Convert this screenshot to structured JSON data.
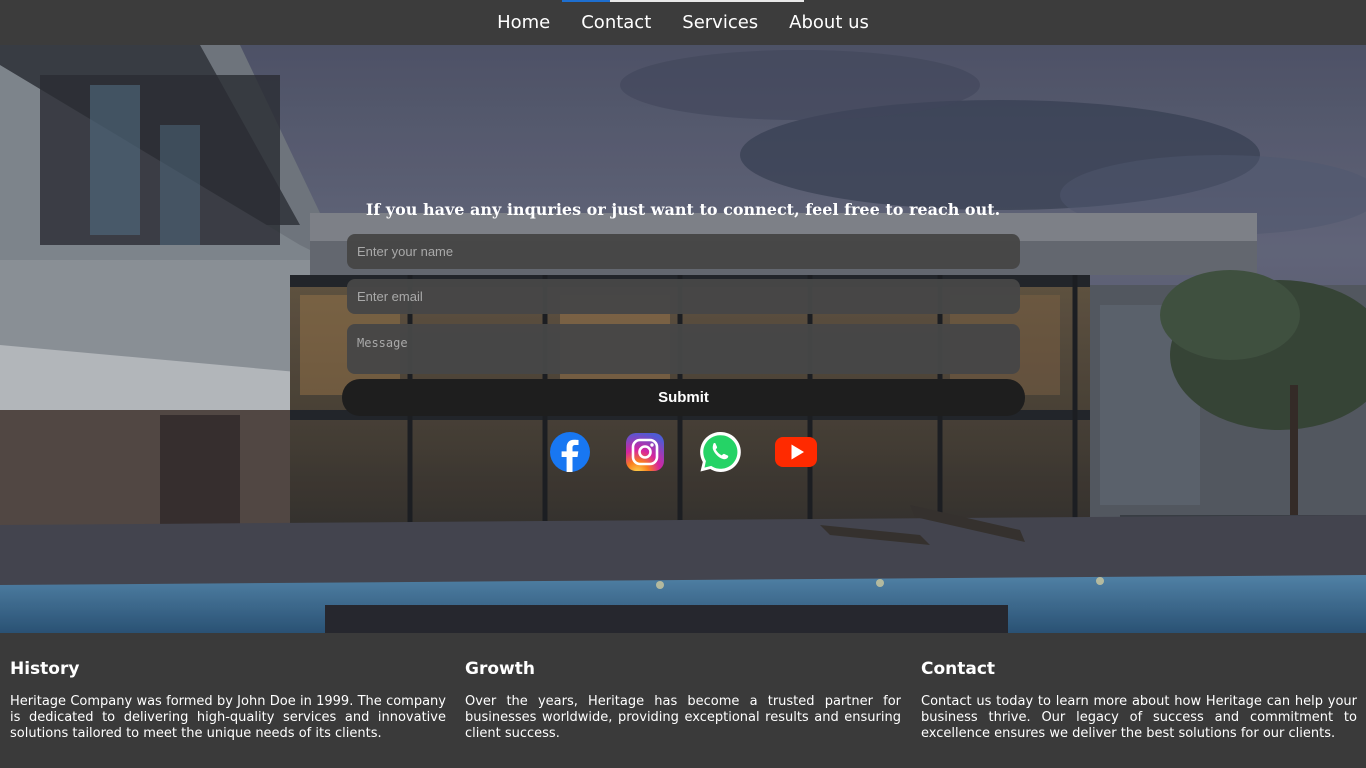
{
  "nav": {
    "items": [
      {
        "label": "Home"
      },
      {
        "label": "Contact"
      },
      {
        "label": "Services"
      },
      {
        "label": "About us"
      }
    ],
    "accent_colors": {
      "blue": "#1e6fd0",
      "white": "#e8e8e8"
    }
  },
  "contact_form": {
    "title": "If you have any inquries or just want to connect, feel free to reach out.",
    "name_placeholder": "Enter your name",
    "email_placeholder": "Enter email",
    "message_placeholder": "Message",
    "submit_label": "Submit"
  },
  "socials": [
    {
      "icon": "facebook-icon",
      "color": "#1877f2"
    },
    {
      "icon": "instagram-icon",
      "color": "#d6249f"
    },
    {
      "icon": "whatsapp-icon",
      "color": "#25d366"
    },
    {
      "icon": "youtube-icon",
      "color": "#ff2a00"
    }
  ],
  "footer": {
    "history": {
      "title": "History",
      "text": "Heritage Company was formed by John Doe in 1999. The company is dedicated to delivering high-quality services and innovative solutions tailored to meet the unique needs of its clients."
    },
    "growth": {
      "title": "Growth",
      "text": "Over the years, Heritage has become a trusted partner for businesses worldwide, providing exceptional results and ensuring client success."
    },
    "contact": {
      "title": "Contact",
      "text": "Contact us today to learn more about how Heritage can help your business thrive. Our legacy of success and commitment to excellence ensures we deliver the best solutions for our clients."
    }
  }
}
